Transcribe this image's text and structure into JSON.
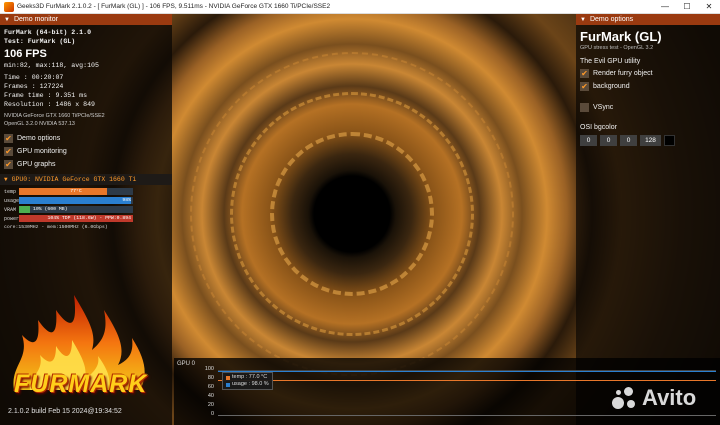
{
  "window": {
    "title": "Geeks3D FurMark 2.1.0.2 - [ FurMark (GL) ] - 106 FPS, 9.511ms - NVIDIA GeForce GTX 1660 Ti/PCIe/SSE2",
    "minimize": "—",
    "maximize": "☐",
    "close": "✕"
  },
  "demo_monitor": {
    "header": "Demo monitor",
    "app_line": "FurMark (64-bit) 2.1.0",
    "test_line": "Test: FurMark (GL)",
    "fps": "106 FPS",
    "fps_stats": "min:82, max:118, avg:105",
    "time": "Time       : 00:20:07",
    "frames": "Frames     : 127224",
    "frame_time": "Frame time : 9.351 ms",
    "resolution": "Resolution : 1486 x 849",
    "gpu_name": "NVIDIA GeForce GTX 1660 Ti/PCIe/SSE2",
    "opengl": "OpenGL 3.2.0 NVIDIA 537.13",
    "options": [
      {
        "label": "Demo options",
        "checked": true
      },
      {
        "label": "GPU monitoring",
        "checked": true
      },
      {
        "label": "GPU graphs",
        "checked": true
      }
    ]
  },
  "gpu_panel": {
    "header": "GPU0: NVIDIA GeForce GTX 1660 Ti",
    "meters": [
      {
        "label": "temp",
        "text": "77°C",
        "fraction": 0.77,
        "color": "#e8772a"
      },
      {
        "label": "usage",
        "text": "98%",
        "fraction": 0.98,
        "color": "#2a7fd0"
      },
      {
        "label": "VRAM",
        "text": "10% (600 MB)",
        "fraction": 0.1,
        "color": "#4caf50"
      },
      {
        "label": "power",
        "text": "104% TDP (118.6W) - PPW:0.894",
        "fraction": 1.0,
        "color": "#c0392b"
      }
    ],
    "core_line": "core:1530MHz - mem:1500MHz (6.0Gbps)"
  },
  "logo": {
    "name": "FURMARK",
    "build": "2.1.0.2 build Feb 15 2024@19:34:52"
  },
  "demo_options": {
    "header": "Demo options",
    "title": "FurMark (GL)",
    "subtitle": "GPU stress test - OpenGL 3.2",
    "utility": "The Evil GPU utility",
    "render_furry": {
      "label": "Render furry object",
      "checked": true
    },
    "background": {
      "label": "background",
      "checked": true
    },
    "vsync": {
      "label": "VSync",
      "checked": false
    },
    "osi_label": "OSI bgcolor",
    "osi_values": [
      "0",
      "0",
      "0",
      "128"
    ],
    "osi_color": "#000000"
  },
  "graph": {
    "title": "GPU 0",
    "ticks": [
      "100",
      "80",
      "60",
      "40",
      "20",
      "0"
    ],
    "legend": [
      {
        "label": "temp : 77.0 °C",
        "color": "#e8772a",
        "value": 77
      },
      {
        "label": "usage : 98.0 %",
        "color": "#2a7fd0",
        "value": 98
      }
    ]
  },
  "watermark": "Avito"
}
